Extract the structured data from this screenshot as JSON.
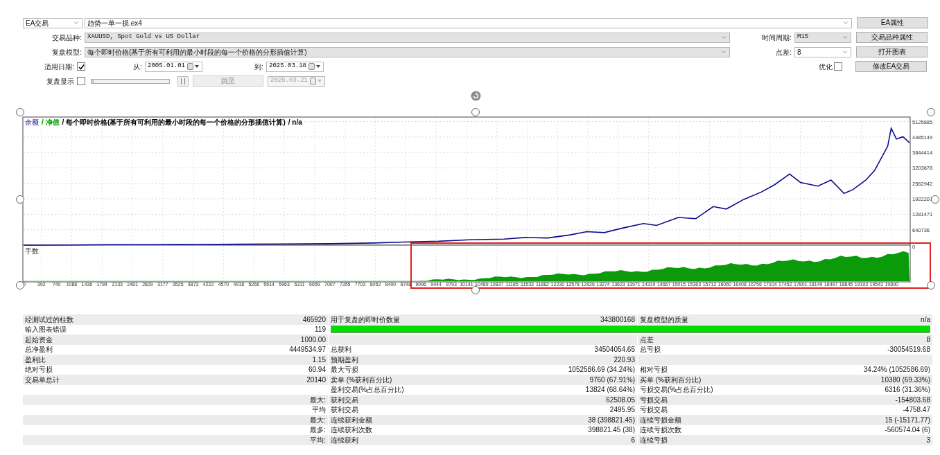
{
  "form": {
    "expert": {
      "value": "EA交易"
    },
    "expert_file": {
      "value": "趋势一单一损.ex4"
    },
    "symbol": {
      "label": "交易品种:",
      "value": "XAUUSD, Spot Gold vs US Dollar"
    },
    "period": {
      "label": "时间周期:",
      "value": "M15"
    },
    "model": {
      "label": "复盘模型:",
      "value": "每个即时价格(基于所有可利用的最小时段的每一个价格的分形插值计算)"
    },
    "spread": {
      "label": "点差:",
      "value": "8"
    },
    "use_date": {
      "label": "适用日期:",
      "checked": true
    },
    "from": {
      "label": "从:",
      "value": "2005.01.01"
    },
    "to": {
      "label": "到:",
      "value": "2025.03.18"
    },
    "optimization": {
      "label": "优化",
      "checked": false
    },
    "visual": {
      "label": "复盘显示",
      "checked": false,
      "level": 0
    },
    "skip_to": {
      "label": "跳至",
      "disabled": true
    },
    "skip_date": {
      "value": "2025.03.21",
      "disabled": true
    },
    "buttons": [
      "EA属性",
      "交易品种属性",
      "打开图表",
      "修改EA交易"
    ]
  },
  "chart": {
    "legend": [
      {
        "text": "/ 净值",
        "color": "#00a000"
      },
      {
        "text": "/ 每个即时价格(基于所有可利用的最小时段的每一个价格的分形插值计算)",
        "color": "#000000"
      },
      {
        "text": "/ n/a",
        "color": "#000000"
      }
    ],
    "lower_pane": {
      "label": "手数",
      "zero": "0"
    },
    "chart_data": {
      "type": "line",
      "grid": true,
      "xlim": [
        0,
        20300
      ],
      "ylim": [
        0,
        5315000
      ],
      "x": [
        0,
        1000,
        2000,
        3000,
        4000,
        5000,
        6000,
        7000,
        8000,
        8700,
        9500,
        10200,
        11000,
        11500,
        12000,
        12500,
        12900,
        13300,
        13700,
        14200,
        14500,
        15000,
        15400,
        15800,
        16100,
        16500,
        16900,
        17200,
        17550,
        17800,
        18200,
        18500,
        18800,
        19000,
        19300,
        19500,
        19650,
        19800,
        19880,
        20000,
        20150,
        20300
      ],
      "series": [
        {
          "name": "余额",
          "color": "#0a0a8c",
          "values": [
            0,
            10000,
            20000,
            20000,
            30000,
            40000,
            50000,
            60000,
            90000,
            130000,
            160000,
            220000,
            250000,
            320000,
            300000,
            420000,
            560000,
            520000,
            700000,
            900000,
            820000,
            1150000,
            1100000,
            1600000,
            1500000,
            1900000,
            2200000,
            2500000,
            2950000,
            2600000,
            2450000,
            2700000,
            2150000,
            2300000,
            2700000,
            3100000,
            3600000,
            4100000,
            4850000,
            4400000,
            4500000,
            4250000
          ]
        }
      ],
      "yticks": [
        {
          "value": 5125885,
          "label": "5125885"
        },
        {
          "value": 4485149,
          "label": "4485149"
        },
        {
          "value": 3844414,
          "label": "3844414"
        },
        {
          "value": 3203678,
          "label": "3203678"
        },
        {
          "value": 2562942,
          "label": "2562942"
        },
        {
          "value": 1922207,
          "label": "1922207"
        },
        {
          "value": 1281471,
          "label": "1281471"
        },
        {
          "value": 640736,
          "label": "640736"
        }
      ],
      "xticks": [
        0,
        392,
        740,
        1088,
        1436,
        1784,
        2133,
        2481,
        2829,
        3177,
        3525,
        3873,
        4222,
        4570,
        4918,
        5266,
        5614,
        5963,
        6311,
        6659,
        7007,
        7355,
        7703,
        8052,
        8400,
        8748,
        9096,
        9444,
        9793,
        10141,
        10489,
        10837,
        11185,
        11533,
        11882,
        12230,
        12578,
        12926,
        13274,
        13623,
        13971,
        14319,
        14667,
        15015,
        15363,
        15712,
        16060,
        16408,
        16756,
        17104,
        17452,
        17801,
        18149,
        18497,
        18845,
        19193,
        19542,
        19890
      ]
    }
  },
  "report": {
    "rows": [
      {
        "cells": [
          {
            "label": "经测试过的柱数",
            "value": "465920"
          },
          {
            "label": "用于复盘的即时价数量",
            "value": "343800168"
          },
          {
            "label": "复盘模型的质量",
            "value": "n/a"
          }
        ]
      },
      {
        "cells": [
          {
            "label": "输入图表错误",
            "value": "119"
          },
          {
            "kind": "bar",
            "level": 1
          }
        ]
      },
      {
        "cells": [
          {
            "label": "起始资金",
            "value": "1000.00"
          },
          null,
          {
            "label": "点差",
            "value": "8"
          }
        ]
      },
      {
        "cells": [
          {
            "label": "总净盈利",
            "value": "4449534.97"
          },
          {
            "label": "总获利",
            "value": "34504054.65"
          },
          {
            "label": "总亏损",
            "value": "-30054519.68"
          }
        ]
      },
      {
        "cells": [
          {
            "label": "盈利比",
            "value": "1.15"
          },
          {
            "label": "预期盈利",
            "value": "220.93"
          },
          null
        ]
      },
      {
        "cells": [
          {
            "label": "绝对亏损",
            "value": "60.94"
          },
          {
            "label": "最大亏损",
            "value": "1052586.69 (34.24%)"
          },
          {
            "label": "相对亏损",
            "value": "34.24% (1052586.69)"
          }
        ]
      },
      {
        "cells": [
          {
            "label": "交易单总计",
            "value": "20140"
          },
          {
            "label": "卖单 (%获利百分比)",
            "value": "9760 (67.91%)"
          },
          {
            "label": "买单 (%获利百分比)",
            "value": "10380 (69.33%)"
          }
        ]
      },
      {
        "cells": [
          null,
          {
            "label": "盈利交易(%占总百分比)",
            "value": "13824 (68.64%)"
          },
          {
            "label": "亏损交易(%占总百分比)",
            "value": "6316 (31.36%)"
          }
        ]
      },
      {
        "cells": [
          {
            "value": "最大:"
          },
          {
            "label": "获利交易",
            "value": "62508.05"
          },
          {
            "label": "亏损交易",
            "value": "-154803.68"
          }
        ]
      },
      {
        "cells": [
          {
            "value": "平均"
          },
          {
            "label": "获利交易",
            "value": "2495.95"
          },
          {
            "label": "亏损交易",
            "value": "-4758.47"
          }
        ]
      },
      {
        "cells": [
          {
            "value": "最大:"
          },
          {
            "label": "连续获利金额",
            "value": "38 (398821.45)"
          },
          {
            "label": "连续亏损金额",
            "value": "15 (-15171.77)"
          }
        ]
      },
      {
        "cells": [
          {
            "value": "最多:"
          },
          {
            "label": "连续获利次数",
            "value": "398821.45 (38)"
          },
          {
            "label": "连续亏损次数",
            "value": "-560574.04 (6)"
          }
        ]
      },
      {
        "cells": [
          {
            "value": "平均:"
          },
          {
            "label": "连续获利",
            "value": "6"
          },
          {
            "label": "连续亏损",
            "value": "3"
          }
        ]
      }
    ]
  }
}
